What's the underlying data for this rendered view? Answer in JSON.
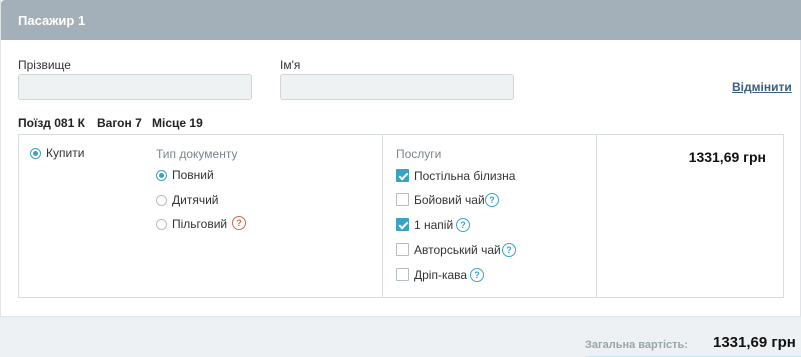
{
  "header": {
    "title": "Пасажир 1"
  },
  "form": {
    "surname_label": "Прізвище",
    "surname_value": "",
    "name_label": "Ім'я",
    "name_value": "",
    "cancel_label": "Відмінити"
  },
  "train_info": {
    "train": "Поїзд 081 К",
    "wagon": "Вагон 7",
    "seat": "Місце 19"
  },
  "purchase": {
    "buy_label": "Купити",
    "doc_type_label": "Тип документу",
    "doc_types": [
      "Повний",
      "Дитячий",
      "Пільговий"
    ],
    "selected_doc_type": "Повний"
  },
  "services": {
    "label": "Послуги",
    "items": [
      {
        "label": "Постільна білизна",
        "checked": true,
        "help": false
      },
      {
        "label": "Бойовий чай",
        "checked": false,
        "help": true
      },
      {
        "label": "1 напій",
        "checked": true,
        "help": true
      },
      {
        "label": "Авторський чай",
        "checked": false,
        "help": true
      },
      {
        "label": "Дріп-кава",
        "checked": false,
        "help": true
      }
    ],
    "help_glyph": "?"
  },
  "price": "1331,69 грн",
  "footer": {
    "total_label": "Загальна вартість:",
    "total_value": "1331,69 грн"
  },
  "colors": {
    "header_bg": "#a3b0b9",
    "accent": "#3aa3c4",
    "help_warning": "#d2694a",
    "link": "#3a5f80"
  },
  "icons": {
    "help": "question-circle-icon",
    "radio": "radio-icon",
    "checkbox": "checkbox-icon"
  }
}
